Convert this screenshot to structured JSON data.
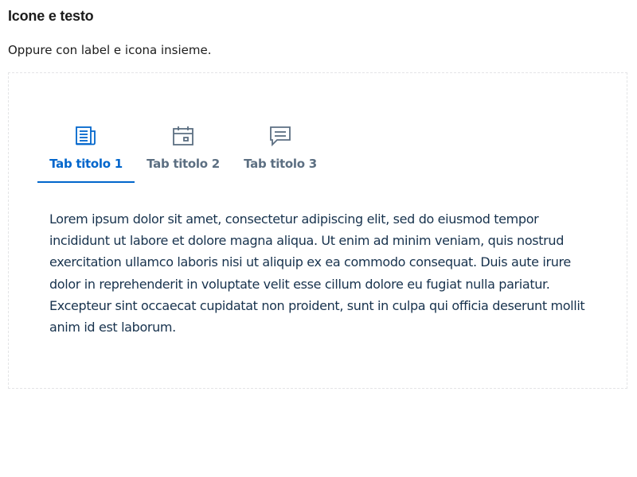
{
  "section": {
    "title": "Icone e testo",
    "description": "Oppure con label e icona insieme."
  },
  "tabs": [
    {
      "label": "Tab titolo 1",
      "icon": "newspaper-icon",
      "active": true
    },
    {
      "label": "Tab titolo 2",
      "icon": "calendar-icon",
      "active": false
    },
    {
      "label": "Tab titolo 3",
      "icon": "comment-icon",
      "active": false
    }
  ],
  "panel": {
    "text": "Lorem ipsum dolor sit amet, consectetur adipiscing elit, sed do eiusmod tempor incididunt ut labore et dolore magna aliqua. Ut enim ad minim veniam, quis nostrud exercitation ullamco laboris nisi ut aliquip ex ea commodo consequat. Duis aute irure dolor in reprehenderit in voluptate velit esse cillum dolore eu fugiat nulla pariatur. Excepteur sint occaecat cupidatat non proident, sunt in culpa qui officia deserunt mollit anim id est laborum."
  },
  "colors": {
    "active": "#0066cc",
    "inactive": "#5c6f82",
    "text": "#17324d",
    "frame_border": "#e3e4e6"
  }
}
